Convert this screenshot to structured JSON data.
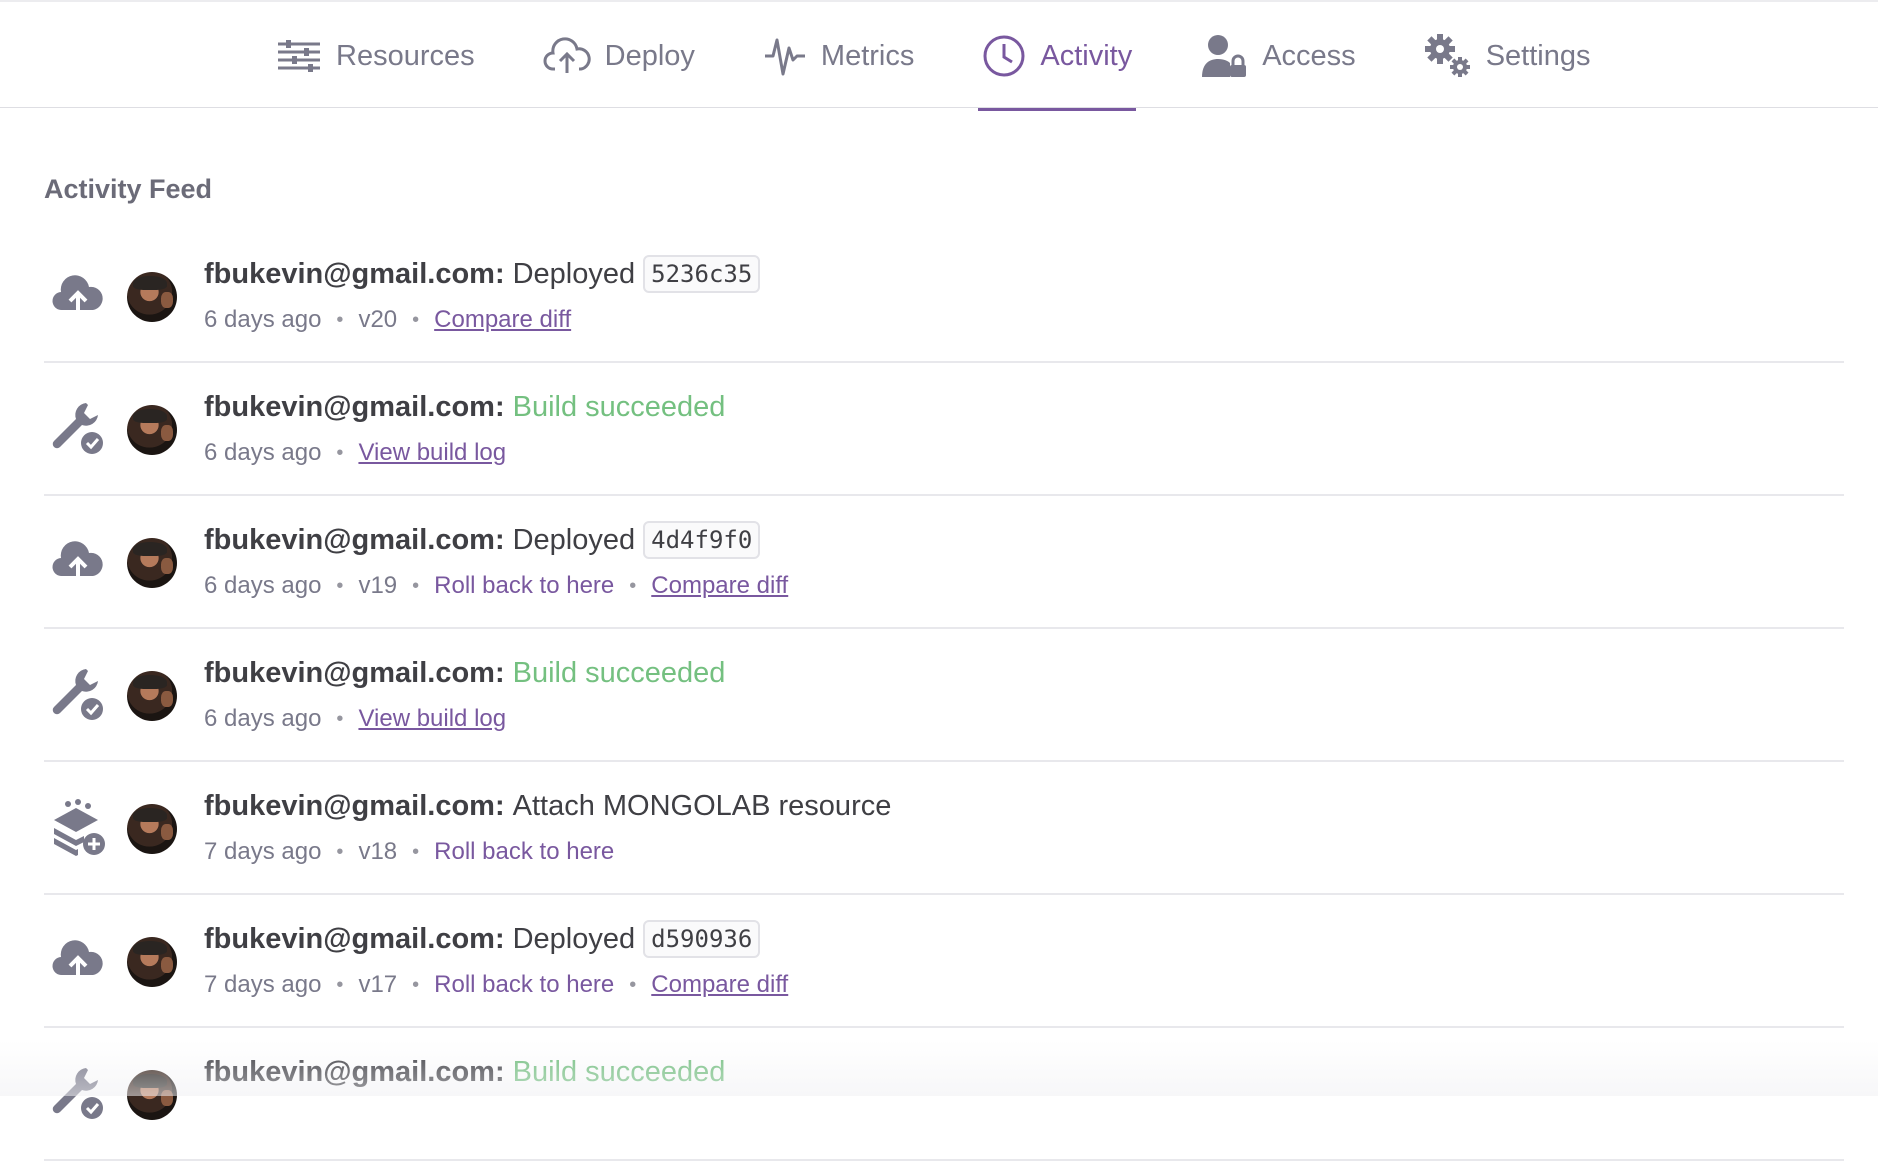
{
  "nav": {
    "tabs": [
      {
        "label": "Resources",
        "icon": "resources-icon",
        "active": false
      },
      {
        "label": "Deploy",
        "icon": "deploy-icon",
        "active": false
      },
      {
        "label": "Metrics",
        "icon": "metrics-icon",
        "active": false
      },
      {
        "label": "Activity",
        "icon": "activity-icon",
        "active": true
      },
      {
        "label": "Access",
        "icon": "access-icon",
        "active": false
      },
      {
        "label": "Settings",
        "icon": "settings-icon",
        "active": false
      }
    ]
  },
  "colors": {
    "accent": "#79589f",
    "success": "#74c080",
    "text": "#3f3f44",
    "muted": "#79798a"
  },
  "feed": {
    "title": "Activity Feed",
    "items": [
      {
        "type": "deploy",
        "icon": "cloud-upload-icon",
        "user": "fbukevin@gmail.com:",
        "action": "Deployed",
        "commit": "5236c35",
        "time": "6 days ago",
        "version": "v20",
        "rollback": "",
        "link": "Compare diff"
      },
      {
        "type": "build",
        "icon": "wrench-check-icon",
        "user": "fbukevin@gmail.com:",
        "action": "Build succeeded",
        "commit": "",
        "time": "6 days ago",
        "version": "",
        "rollback": "",
        "link": "View build log"
      },
      {
        "type": "deploy",
        "icon": "cloud-upload-icon",
        "user": "fbukevin@gmail.com:",
        "action": "Deployed",
        "commit": "4d4f9f0",
        "time": "6 days ago",
        "version": "v19",
        "rollback": "Roll back to here",
        "link": "Compare diff"
      },
      {
        "type": "build",
        "icon": "wrench-check-icon",
        "user": "fbukevin@gmail.com:",
        "action": "Build succeeded",
        "commit": "",
        "time": "6 days ago",
        "version": "",
        "rollback": "",
        "link": "View build log"
      },
      {
        "type": "addon",
        "icon": "addon-attach-icon",
        "user": "fbukevin@gmail.com:",
        "action": "Attach MONGOLAB resource",
        "commit": "",
        "time": "7 days ago",
        "version": "v18",
        "rollback": "Roll back to here",
        "link": ""
      },
      {
        "type": "deploy",
        "icon": "cloud-upload-icon",
        "user": "fbukevin@gmail.com:",
        "action": "Deployed",
        "commit": "d590936",
        "time": "7 days ago",
        "version": "v17",
        "rollback": "Roll back to here",
        "link": "Compare diff"
      },
      {
        "type": "build",
        "icon": "wrench-check-icon",
        "user": "fbukevin@gmail.com:",
        "action": "Build succeeded",
        "commit": "",
        "time": "",
        "version": "",
        "rollback": "",
        "link": ""
      }
    ]
  }
}
